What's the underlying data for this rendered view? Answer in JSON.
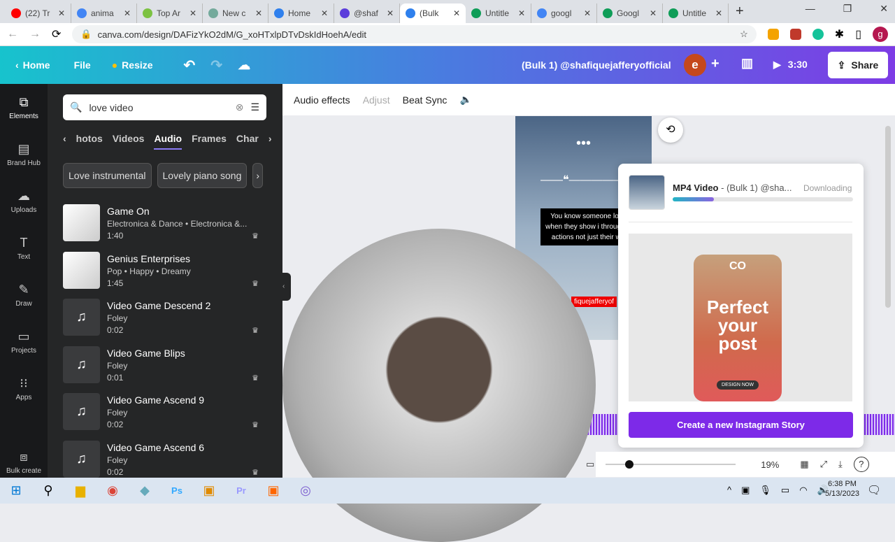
{
  "browser": {
    "tabs": [
      {
        "label": "(22) Tr",
        "color": "#ff0000"
      },
      {
        "label": "anima",
        "color": "#4285f4"
      },
      {
        "label": "Top Ar",
        "color": "#7cc242"
      },
      {
        "label": "New c",
        "color": "#74aa9c"
      },
      {
        "label": "Home",
        "color": "#2f80ed"
      },
      {
        "label": "@shaf",
        "color": "#5b3ddb"
      },
      {
        "label": "(Bulk",
        "color": "#2f80ed"
      },
      {
        "label": "Untitle",
        "color": "#0f9d58"
      },
      {
        "label": "googl",
        "color": "#4285f4"
      },
      {
        "label": "Googl",
        "color": "#0f9d58"
      },
      {
        "label": "Untitle",
        "color": "#0f9d58"
      }
    ],
    "active_tab": 6,
    "url": "canva.com/design/DAFizYkO2dM/G_xoHTxlpDTvDskIdHoehA/edit",
    "profile": "g"
  },
  "header": {
    "home": "Home",
    "file": "File",
    "resize": "Resize",
    "title": "(Bulk 1) @shafiquejafferyofficial",
    "avatar": "e",
    "duration": "3:30",
    "share": "Share"
  },
  "rail": [
    {
      "label": "Elements",
      "icon": "elements-icon"
    },
    {
      "label": "Brand Hub",
      "icon": "brand-icon"
    },
    {
      "label": "Uploads",
      "icon": "upload-icon"
    },
    {
      "label": "Text",
      "icon": "text-icon"
    },
    {
      "label": "Draw",
      "icon": "draw-icon"
    },
    {
      "label": "Projects",
      "icon": "folder-icon"
    },
    {
      "label": "Apps",
      "icon": "apps-icon"
    },
    {
      "label": "Bulk create",
      "icon": "bulk-icon"
    }
  ],
  "panel": {
    "search": "love video",
    "categories": [
      "hotos",
      "Videos",
      "Audio",
      "Frames",
      "Char"
    ],
    "active_category": 2,
    "chips": [
      "Love instrumental",
      "Lovely piano song"
    ],
    "tracks": [
      {
        "title": "Game On",
        "meta": "Electronica & Dance • Electronica &...",
        "duration": "1:40"
      },
      {
        "title": "Genius Enterprises",
        "meta": "Pop • Happy • Dreamy",
        "duration": "1:45"
      },
      {
        "title": "Video Game Descend 2",
        "meta": "Foley",
        "duration": "0:02"
      },
      {
        "title": "Video Game Blips",
        "meta": "Foley",
        "duration": "0:01"
      },
      {
        "title": "Video Game Ascend 9",
        "meta": "Foley",
        "duration": "0:02"
      },
      {
        "title": "Video Game Ascend 6",
        "meta": "Foley",
        "duration": "0:02"
      }
    ]
  },
  "toolbar": {
    "audio_effects": "Audio effects",
    "adjust": "Adjust",
    "beat_sync": "Beat Sync"
  },
  "canvas": {
    "quote": "You know someone lov you when they show i through their actions not just their words",
    "handle": "fiquejafferyof"
  },
  "download": {
    "name": "MP4 Video",
    "detail": "- (Bulk 1) @sha...",
    "status": "Downloading",
    "progress": 0.23,
    "promo_logo": "CO",
    "promo_text": "Perfect your post",
    "promo_button": "DESIGN NOW",
    "cta": "Create a new Instagram Story"
  },
  "bottom": {
    "zoom": "19%",
    "zoom_value": 0.19
  },
  "taskbar": {
    "time": "6:38 PM",
    "date": "5/13/2023"
  }
}
